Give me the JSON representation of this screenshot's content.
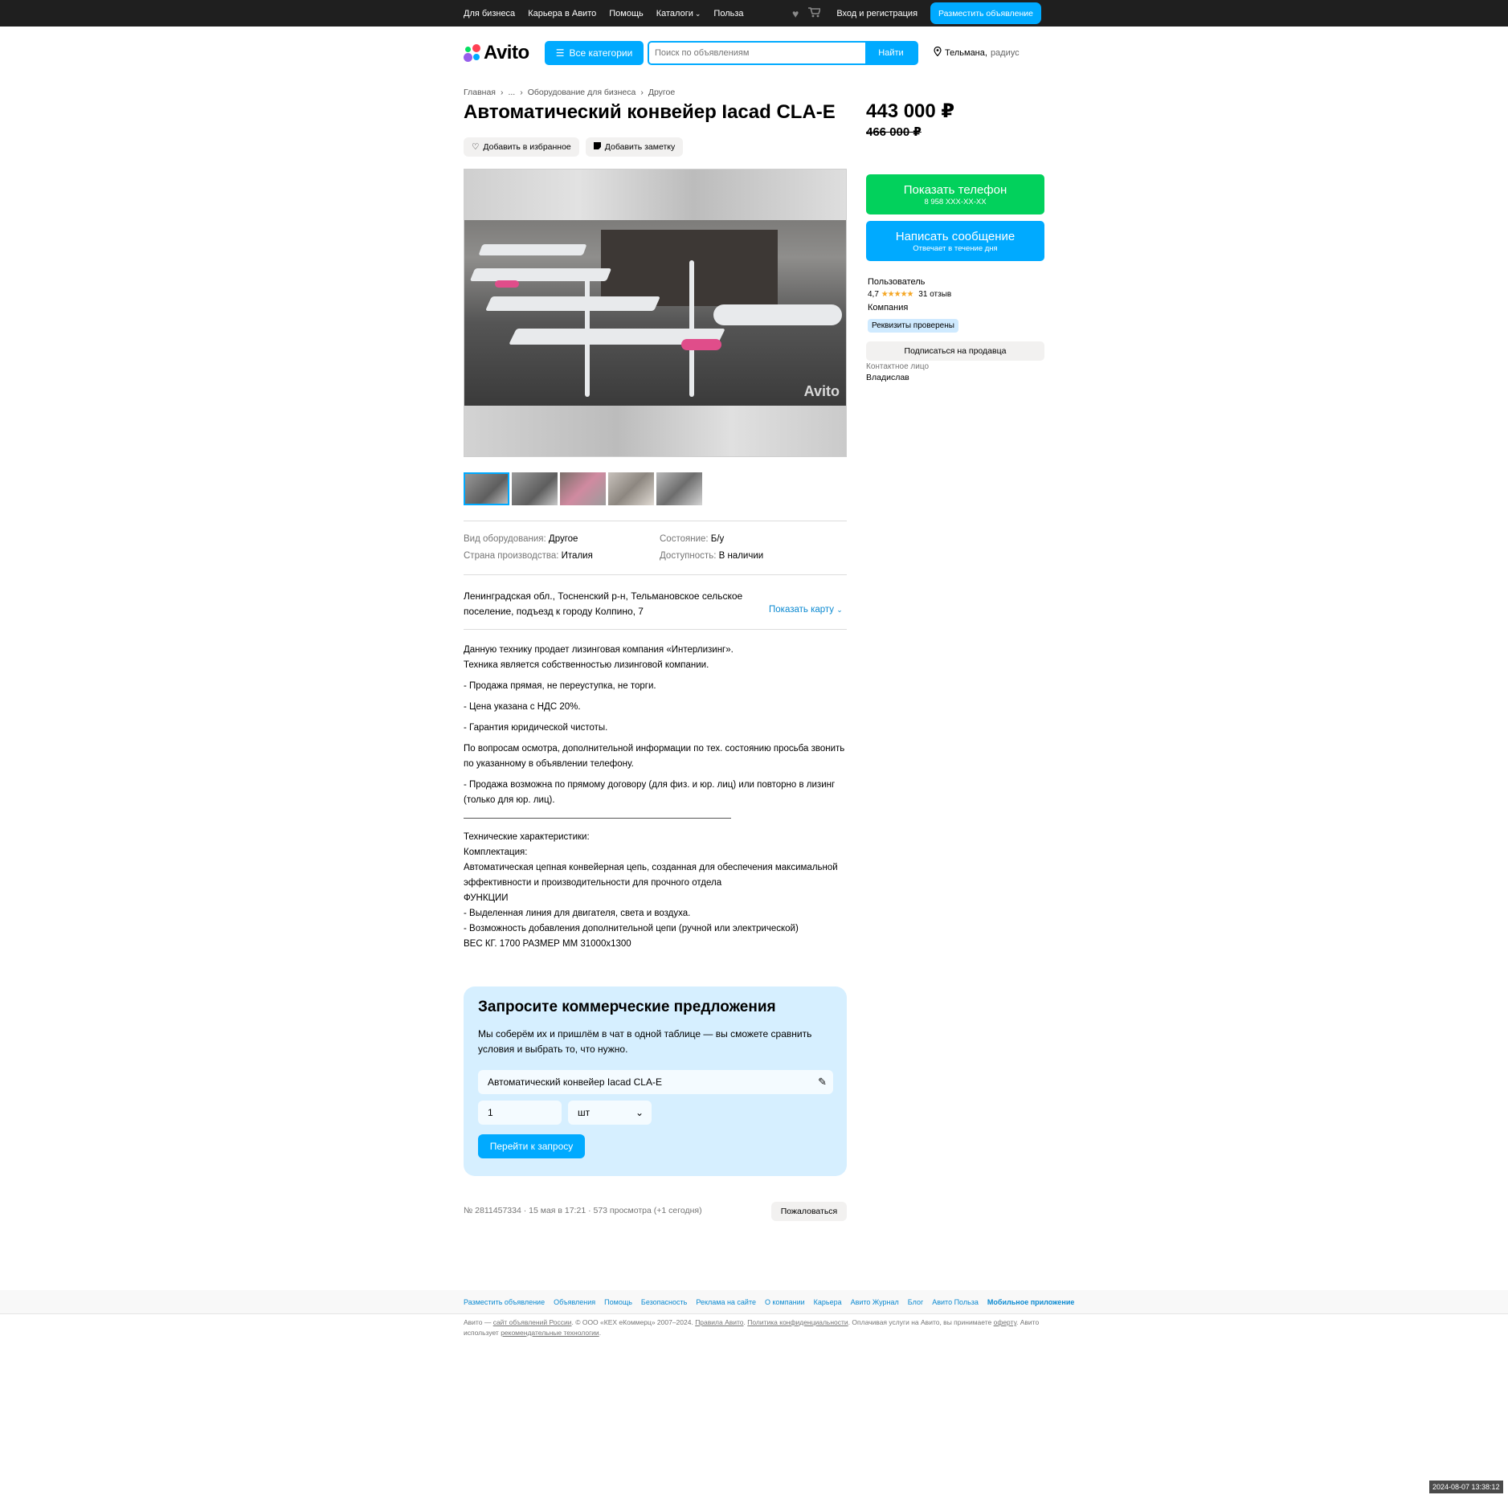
{
  "topbar": {
    "nav": [
      "Для бизнеса",
      "Карьера в Авито",
      "Помощь",
      "Каталоги",
      "Польза"
    ],
    "catalog_chevron": "⌄",
    "login": "Вход и регистрация",
    "post_ad": "Разместить объявление"
  },
  "header": {
    "logo": "Avito",
    "categories": "Все категории",
    "search_placeholder": "Поиск по объявлениям",
    "search_button": "Найти",
    "location": "Тельмана,",
    "radius": "радиус"
  },
  "breadcrumb": [
    "Главная",
    "...",
    "Оборудование для бизнеса",
    "Другое"
  ],
  "title": "Автоматический конвейер Iacad CLA-E",
  "actions": {
    "favorite": "Добавить в избранное",
    "note": "Добавить заметку"
  },
  "gallery": {
    "watermark": "Avito"
  },
  "params": [
    {
      "k": "Вид оборудования:",
      "v": "Другое"
    },
    {
      "k": "Состояние:",
      "v": "Б/у"
    },
    {
      "k": "Страна производства:",
      "v": "Италия"
    },
    {
      "k": "Доступность:",
      "v": "В наличии"
    }
  ],
  "address": "Ленинградская обл., Тосненский р-н, Тельмановское сельское поселение, подъезд к городу Колпино, 7",
  "show_map": "Показать карту",
  "description": {
    "p1a": "Данную технику продает лизинговая компания «Интерлизинг».",
    "p1b": "Техника является собственностью лизинговой компании.",
    "p2": "- Продажа прямая, не переуступка, не торги.",
    "p3": "- Цена указана с НДС 20%.",
    "p4": "- Гарантия юридической чистоты.",
    "p5": "По вопросам осмотра, дополнительной информации по тех. состоянию просьба звонить по указанному в объявлении телефону.",
    "p6": "- Продажа возможна по прямому договору (для физ. и юр. лиц) или повторно в лизинг (только для юр. лиц).",
    "t1": "Технические характеристики:",
    "t2": "Комплектация:",
    "t3": "Автоматическая цепная конвейерная цепь, созданная для обеспечения максимальной эффективности и производительности для прочного отдела",
    "t4": "ФУНКЦИИ",
    "t5": "- Выделенная линия для двигателя, света и воздуха.",
    "t6": "- Возможность добавления дополнительной цепи (ручной или электрической)",
    "t7": "ВЕС КГ. 1700 РАЗМЕР ММ 31000х1300"
  },
  "request": {
    "heading": "Запросите коммерческие предложения",
    "sub": "Мы соберём их и пришлём в чат в одной таблице — вы сможете сравнить условия и выбрать то, что нужно.",
    "item": "Автоматический конвейер Iacad CLA-E",
    "qty": "1",
    "unit": "шт",
    "button": "Перейти к запросу"
  },
  "meta": "№ 2811457334 · 15 мая в 17:21 · 573 просмотра (+1 сегодня)",
  "complain": "Пожаловаться",
  "sidebar": {
    "price": "443 000 ₽",
    "old_price": "466 000 ₽",
    "show_phone": "Показать телефон",
    "phone_mask": "8 958 XXX-XX-XX",
    "write": "Написать сообщение",
    "reply_time": "Отвечает в течение дня",
    "seller_name": "Пользователь",
    "rating": "4,7",
    "stars": "★★★★★",
    "reviews": "31 отзыв",
    "seller_type": "Компания",
    "verified": "Реквизиты проверены",
    "subscribe": "Подписаться на продавца",
    "contact_label": "Контактное лицо",
    "contact_name": "Владислав"
  },
  "footer": {
    "links": [
      "Разместить объявление",
      "Объявления",
      "Помощь",
      "Безопасность",
      "Реклама на сайте",
      "О компании",
      "Карьера",
      "Авито Журнал",
      "Блог",
      "Авито Польза",
      "Мобильное приложение"
    ],
    "legal_a": "Авито — ",
    "legal_b": "сайт объявлений России",
    "legal_c": ". © ООО «КЕХ еКоммерц» 2007–2024. ",
    "legal_d": "Правила Авито",
    "legal_e": ". ",
    "legal_f": "Политика конфиденциальности",
    "legal_g": ". Оплачивая услуги на Авито, вы принимаете ",
    "legal_h": "оферту",
    "legal_i": ". Авито использует ",
    "legal_j": "рекомендательные технологии",
    "legal_k": "."
  },
  "timestamp": "2024-08-07 13:38:12",
  "colors": {
    "accent": "#00aaff",
    "green": "#02d15c",
    "topbar": "#1f1f1f"
  }
}
